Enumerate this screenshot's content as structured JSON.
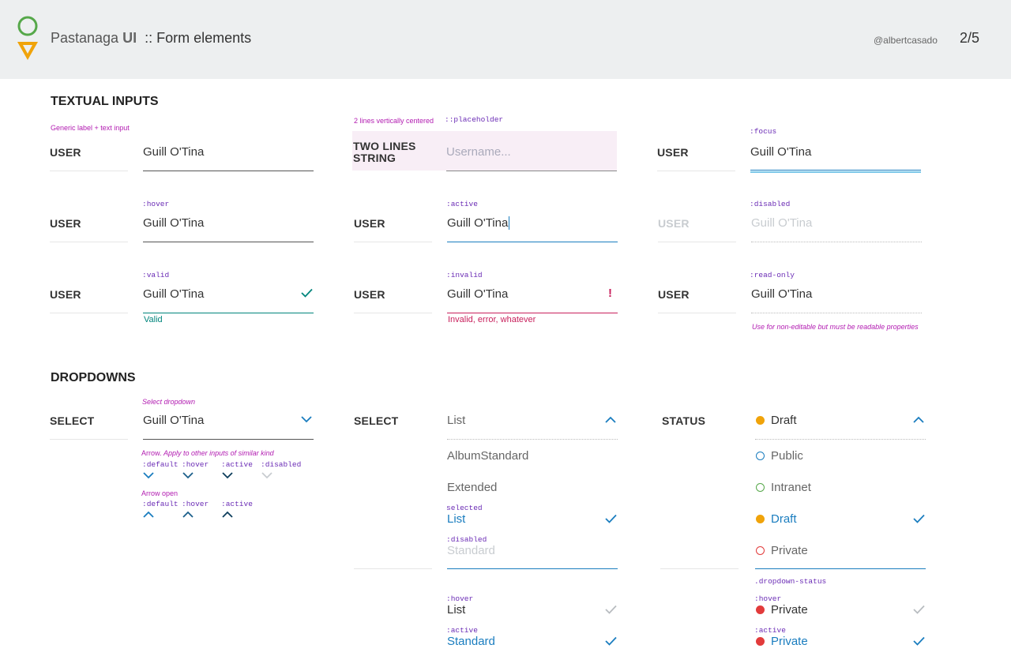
{
  "header": {
    "app_name": "Pastanaga",
    "app_bold": "UI",
    "separator": "::",
    "page_title": "Form elements",
    "handle": "@albertcasado",
    "pager": "2/5"
  },
  "textual": {
    "title": "TEXTUAL INPUTS",
    "generic_note": "Generic label + text input",
    "twolines_note": "2 lines vertically centered",
    "placeholder_note": "::placeholder",
    "focus_note": ":focus",
    "hover_note": ":hover",
    "active_note": ":active",
    "disabled_note": ":disabled",
    "valid_note": ":valid",
    "invalid_note": ":invalid",
    "readonly_note": ":read-only",
    "label": "USER",
    "twolines_label_1": "TWO LINES",
    "twolines_label_2": "STRING",
    "value": "Guill O'Tina",
    "placeholder": "Username...",
    "valid_message": "Valid",
    "invalid_message": "Invalid, error, whatever",
    "readonly_message": "Use for non-editable but must be readable properties"
  },
  "dropdowns": {
    "title": "DROPDOWNS",
    "select_note": "Select dropdown",
    "select_label": "SELECT",
    "status_label": "STATUS",
    "select_value": "Guill O'Tina",
    "arrow_note_1": "Arrow.",
    "arrow_note_2": "Apply to other inputs of similar kind",
    "arrow_states": [
      ":default",
      ":hover",
      ":active",
      ":disabled"
    ],
    "arrow_open_note": "Arrow open",
    "arrow_open_states": [
      ":default",
      ":hover",
      ":active"
    ],
    "list_header": "List",
    "list_items": [
      "AlbumStandard",
      "Extended"
    ],
    "selected_note": "selected",
    "selected_value": "List",
    "disabled_note": ":disabled",
    "disabled_value": "Standard",
    "hover_note": ":hover",
    "hover_value": "List",
    "active_note": ":active",
    "active_value": "Standard",
    "status_header": "Draft",
    "status_items": [
      "Public",
      "Intranet",
      "Draft",
      "Private"
    ],
    "status_class_note": ".dropdown-status",
    "status_hover_note": ":hover",
    "status_hover_value": "Private",
    "status_active_note": ":active",
    "status_active_value": "Private"
  },
  "colors": {
    "accent_blue": "#1a7dbf",
    "valid_green": "#00857c",
    "error_red": "#c8205c",
    "draft_orange": "#f0a30a",
    "public_blue": "#1a7dbf",
    "intranet_green": "#56a84a",
    "private_red": "#e23b3b",
    "note_magenta": "#b21cb1",
    "state_purple": "#6a2bb5"
  }
}
